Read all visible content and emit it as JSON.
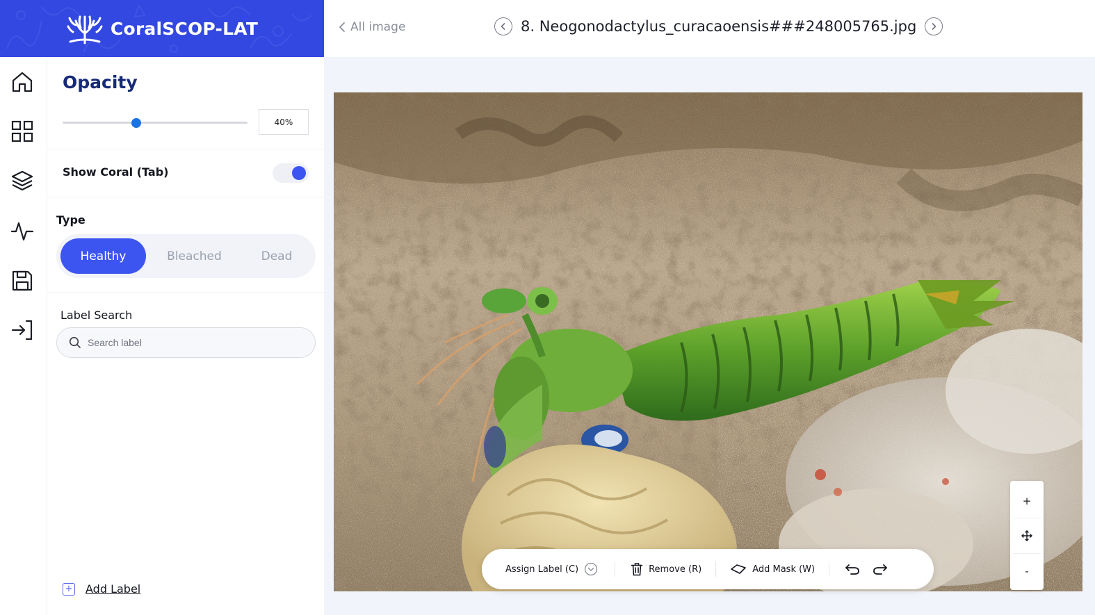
{
  "brand": {
    "title": "CoralSCOP-LAT",
    "color": "#3348e0"
  },
  "header": {
    "back_label": "All image",
    "file_title": "8. Neogonodactylus_curacaoensis###248005765.jpg"
  },
  "rail": {
    "items": [
      {
        "icon": "home-icon"
      },
      {
        "icon": "grid-icon"
      },
      {
        "icon": "layers-icon"
      },
      {
        "icon": "activity-icon"
      },
      {
        "icon": "save-icon"
      },
      {
        "icon": "logout-icon"
      }
    ]
  },
  "opacity": {
    "title": "Opacity",
    "value": "40%",
    "fraction": 0.4
  },
  "show_coral": {
    "label": "Show Coral (Tab)",
    "enabled": true
  },
  "type": {
    "title": "Type",
    "options": [
      "Healthy",
      "Bleached",
      "Dead"
    ],
    "selected": "Healthy"
  },
  "label_search": {
    "title": "Label Search",
    "placeholder": "Search label"
  },
  "add_label": {
    "label": "Add Label"
  },
  "toolbar": {
    "assign_label": "Assign Label (C)",
    "remove": "Remove (R)",
    "add_mask": "Add Mask (W)"
  },
  "zoom": {
    "plus": "+",
    "minus": "-"
  },
  "colors": {
    "accent": "#3d55f0",
    "heading": "#162a78",
    "canvas_bg": "#f1f4fa"
  }
}
